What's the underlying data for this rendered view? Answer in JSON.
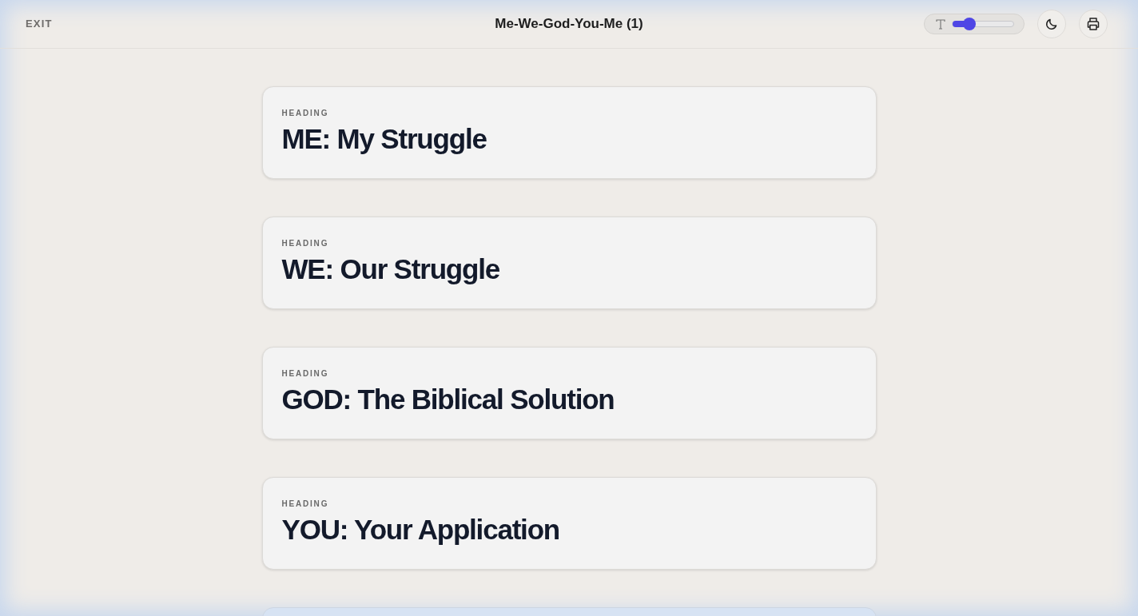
{
  "header": {
    "exit": "EXIT",
    "title": "Me-We-God-You-Me (1)",
    "text_size": {
      "level": 0.28
    }
  },
  "sections": [
    {
      "kind": "heading",
      "label": "HEADING",
      "title": "ME: My Struggle"
    },
    {
      "kind": "heading",
      "label": "HEADING",
      "title": "WE: Our Struggle"
    },
    {
      "kind": "heading",
      "label": "HEADING",
      "title": "GOD: The Biblical Solution"
    },
    {
      "kind": "heading",
      "label": "HEADING",
      "title": "YOU: Your Application"
    }
  ]
}
